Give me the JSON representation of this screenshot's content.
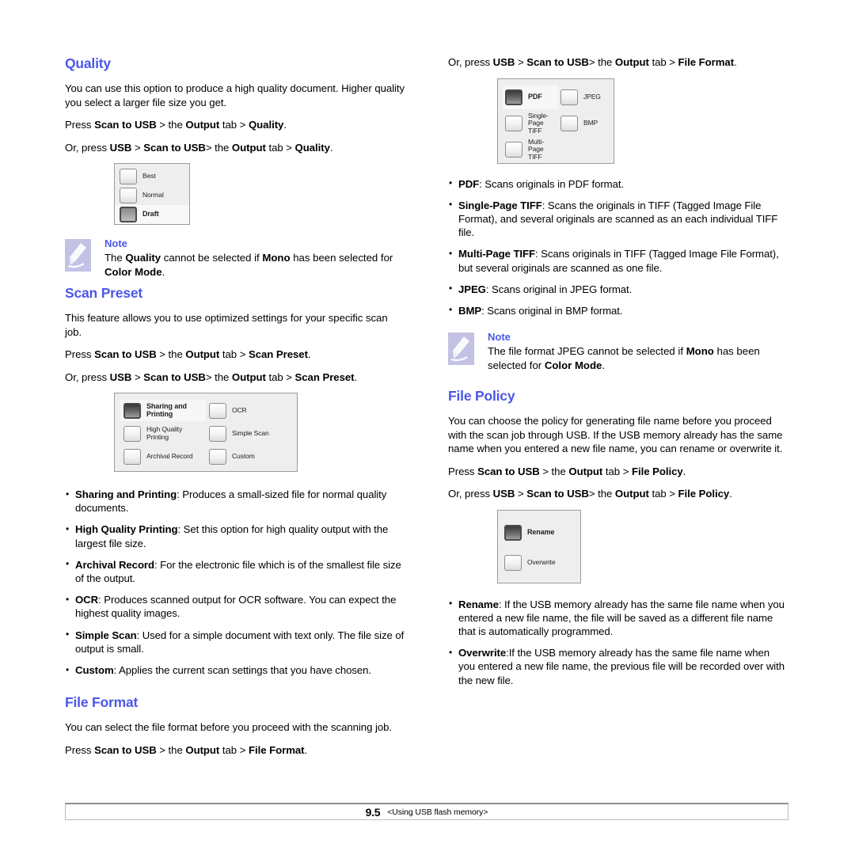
{
  "footer": {
    "page_number": "9.5",
    "chapter_label": "<Using USB flash memory>"
  },
  "left_column": {
    "quality": {
      "heading": "Quality",
      "intro": "You can use this option to produce a high quality document. Higher quality you select a larger file size you get.",
      "press_line_prefix": "Press ",
      "path1": {
        "b1": "Scan to USB",
        "t1": " > the ",
        "b2": "Output",
        "t2": " tab > ",
        "b3": "Quality",
        "t3": "."
      },
      "path2": {
        "pre": "Or, press ",
        "b1": "USB",
        "t1": " > ",
        "b2": "Scan to USB",
        "t2": "> the ",
        "b3": "Output",
        "t3": " tab > ",
        "b4": "Quality",
        "t4": "."
      },
      "dialog": {
        "options": [
          {
            "label": "Best",
            "selected": false
          },
          {
            "label": "Normal",
            "selected": false
          },
          {
            "label": "Draft",
            "selected": true
          }
        ]
      },
      "note": {
        "title": "Note",
        "part1": "The ",
        "b1": "Quality",
        "part2": " cannot be selected if ",
        "b2": "Mono",
        "part3": " has been selected for ",
        "b3": "Color Mode",
        "part4": "."
      }
    },
    "scan_preset": {
      "heading": "Scan Preset",
      "intro": "This feature allows you to use optimized settings for your specific scan job.",
      "path1": {
        "pre": "Press ",
        "b1": "Scan to USB",
        "t1": " > the ",
        "b2": "Output",
        "t2": " tab > ",
        "b3": "Scan Preset",
        "t3": "."
      },
      "path2": {
        "pre": "Or, press ",
        "b1": "USB",
        "t1": " > ",
        "b2": "Scan to USB",
        "t2": "> the ",
        "b3": "Output",
        "t3": " tab > ",
        "b4": "Scan Preset",
        "t4": "."
      },
      "dialog": {
        "rows": [
          [
            {
              "label": "Sharing and Printing",
              "selected": true
            },
            {
              "label": "OCR",
              "selected": false
            }
          ],
          [
            {
              "label": "High Quality Printing",
              "selected": false
            },
            {
              "label": "Simple Scan",
              "selected": false
            }
          ],
          [
            {
              "label": "Archival Record",
              "selected": false
            },
            {
              "label": "Custom",
              "selected": false
            }
          ]
        ]
      },
      "bullets": [
        {
          "term": "Sharing and Printing",
          "text": ": Produces a small-sized file for normal quality documents."
        },
        {
          "term": "High Quality Printing",
          "text": ": Set this option for high quality output with the largest file size."
        },
        {
          "term": "Archival Record",
          "text": ": For the electronic file which is of the smallest file size of the output."
        },
        {
          "term": "OCR",
          "text": ": Produces scanned output for OCR software. You can expect the highest quality images."
        },
        {
          "term": "Simple Scan",
          "text": ": Used for a simple document with text only. The file size of output is small."
        },
        {
          "term": "Custom",
          "text": ": Applies the current scan settings that you have chosen."
        }
      ]
    },
    "file_format": {
      "heading": "File Format",
      "intro": "You can select the file format before you proceed with the scanning job.",
      "path1": {
        "pre": "Press ",
        "b1": "Scan to USB",
        "t1": " > the ",
        "b2": "Output",
        "t2": " tab > ",
        "b3": "File Format",
        "t3": "."
      }
    }
  },
  "right_column": {
    "file_format_cont": {
      "path2": {
        "pre": "Or, press ",
        "b1": "USB",
        "t1": " > ",
        "b2": "Scan to USB",
        "t2": "> the ",
        "b3": "Output",
        "t3": " tab > ",
        "b4": "File Format",
        "t4": "."
      },
      "dialog": {
        "rows": [
          [
            {
              "label": "PDF",
              "selected": true
            },
            {
              "label": "JPEG",
              "selected": false
            }
          ],
          [
            {
              "label": "Single-Page TIFF",
              "selected": false
            },
            {
              "label": "BMP",
              "selected": false
            }
          ],
          [
            {
              "label": "Multi-Page TIFF",
              "selected": false
            },
            {
              "label": "",
              "selected": false
            }
          ]
        ]
      },
      "bullets": [
        {
          "term": "PDF",
          "text": ": Scans originals in PDF format."
        },
        {
          "term": "Single-Page TIFF",
          "text": ": Scans the originals in TIFF (Tagged Image File Format), and several originals are scanned as an each individual TIFF file."
        },
        {
          "term": "Multi-Page TIFF",
          "text": ": Scans originals in TIFF (Tagged Image File Format), but several originals are scanned as one file."
        },
        {
          "term": "JPEG",
          "text": ": Scans original in JPEG format."
        },
        {
          "term": "BMP",
          "text": ": Scans original in BMP format."
        }
      ],
      "note": {
        "title": "Note",
        "part1": "The file format JPEG cannot be selected if ",
        "b1": "Mono",
        "part2": " has been selected for ",
        "b2": "Color Mode",
        "part3": "."
      }
    },
    "file_policy": {
      "heading": "File Policy",
      "intro": "You can choose the policy for generating file name before you proceed with the scan job through USB. If the USB memory already has the same name when you entered a new file name, you can rename or overwrite it.",
      "path1": {
        "pre": "Press ",
        "b1": "Scan to USB",
        "t1": " > the ",
        "b2": "Output",
        "t2": " tab > ",
        "b3": "File Policy",
        "t3": "."
      },
      "path2": {
        "pre": "Or, press ",
        "b1": "USB",
        "t1": " > ",
        "b2": "Scan to USB",
        "t2": "> the ",
        "b3": "Output",
        "t3": " tab > ",
        "b4": "File Policy",
        "t4": "."
      },
      "dialog": {
        "options": [
          {
            "label": "Rename",
            "selected": true
          },
          {
            "label": "Overwrite",
            "selected": false
          }
        ]
      },
      "bullets": [
        {
          "term": "Rename",
          "text": ":  If the USB memory already has the same file name when you entered a new file name, the file will be saved as a different file name that is automatically programmed."
        },
        {
          "term": "Overwrite",
          "text": ":If the USB memory already has the same file name when you entered a new file name, the previous file will be recorded over with the new file."
        }
      ]
    }
  }
}
